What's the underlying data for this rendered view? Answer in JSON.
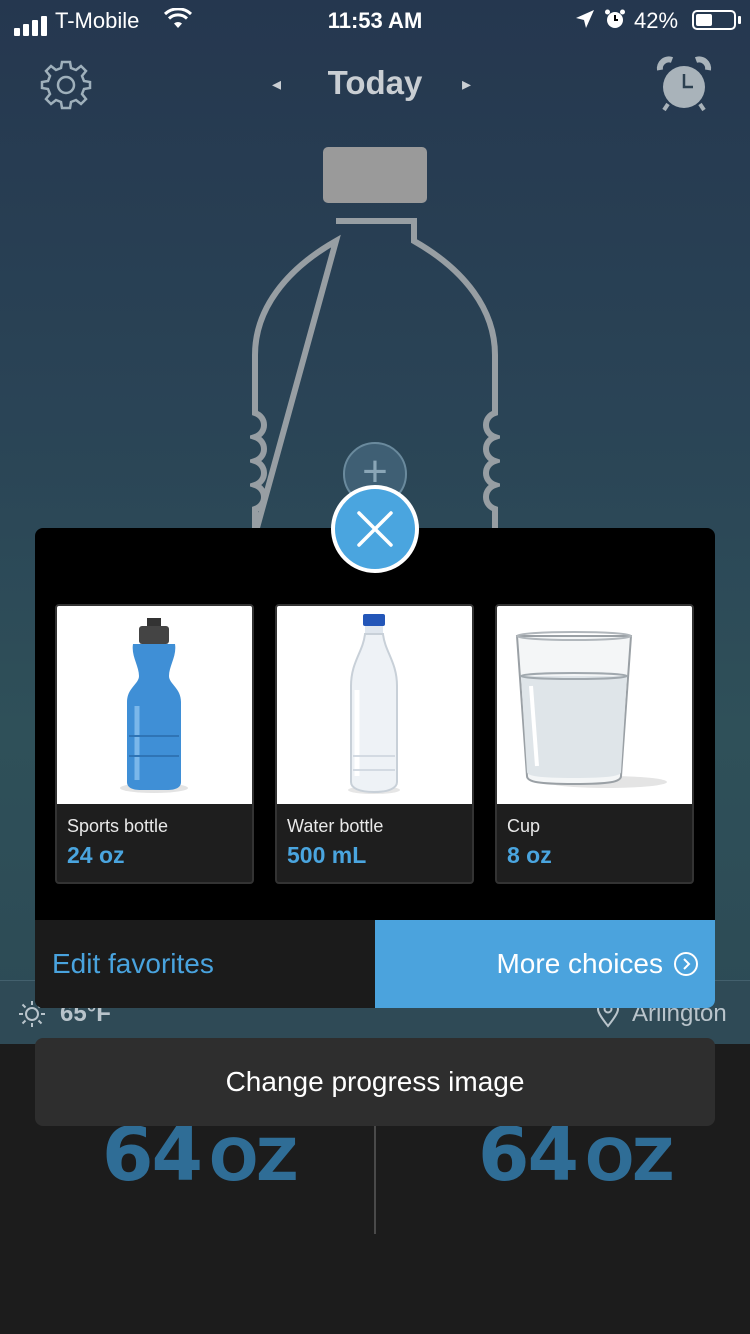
{
  "status_bar": {
    "carrier": "T-Mobile",
    "time": "11:53 AM",
    "battery": "42%"
  },
  "header": {
    "title": "Today",
    "prev_arrow": "◂",
    "next_arrow": "▸"
  },
  "weather": {
    "temperature": "65°F",
    "location": "Arlington"
  },
  "totals": {
    "left": {
      "value": "64",
      "unit": "OZ"
    },
    "right": {
      "value": "64",
      "unit": "OZ"
    }
  },
  "dialog": {
    "favorites": [
      {
        "name": "Sports bottle",
        "size": "24 oz",
        "icon": "sports-bottle"
      },
      {
        "name": "Water bottle",
        "size": "500 mL",
        "icon": "water-bottle"
      },
      {
        "name": "Cup",
        "size": "8 oz",
        "icon": "glass-cup"
      }
    ],
    "edit_label": "Edit favorites",
    "more_label": "More choices"
  },
  "change_progress_label": "Change progress image",
  "colors": {
    "accent": "#4ba3dd",
    "dialog_bg": "#000000",
    "total_text": "#2f6d96"
  }
}
